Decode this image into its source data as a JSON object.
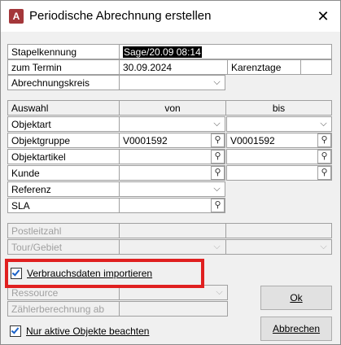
{
  "window": {
    "title": "Periodische Abrechnung erstellen",
    "app_icon_letter": "A",
    "close_glyph": "✕"
  },
  "header_fields": {
    "stapelkennung_label": "Stapelkennung",
    "stapelkennung_value": "Sage/20.09 08:14",
    "termin_label": "zum Termin",
    "termin_value": "30.09.2024",
    "karenztage_label": "Karenztage",
    "karenztage_value": "",
    "abrechnungskreis_label": "Abrechnungskreis",
    "abrechnungskreis_value": ""
  },
  "selection_table": {
    "headers": [
      "Auswahl",
      "von",
      "bis"
    ],
    "rows": [
      {
        "label": "Objektart",
        "von": "",
        "bis": "",
        "control": "dropdown"
      },
      {
        "label": "Objektgruppe",
        "von": "V0001592",
        "bis": "V0001592",
        "control": "lookup"
      },
      {
        "label": "Objektartikel",
        "von": "",
        "bis": "",
        "control": "lookup"
      },
      {
        "label": "Kunde",
        "von": "",
        "bis": "",
        "control": "lookup"
      },
      {
        "label": "Referenz",
        "von": "",
        "control": "dropdown_single"
      },
      {
        "label": "SLA",
        "von": "",
        "control": "lookup_single"
      }
    ]
  },
  "disabled_fields": {
    "postleitzahl_label": "Postleitzahl",
    "tour_label": "Tour/Gebiet",
    "ressource_label": "Ressource",
    "zaehler_label": "Zählerberechnung ab"
  },
  "checkboxes": {
    "verbrauchsdaten_label": "Verbrauchsdaten importieren",
    "verbrauchsdaten_checked": true,
    "nur_aktive_label": "Nur aktive Objekte beachten",
    "nur_aktive_checked": true
  },
  "buttons": {
    "ok_label": "Ok",
    "abbrechen_label": "Abbrechen"
  },
  "icons": {
    "dropdown": "chevron-down-icon",
    "lookup": "magnifier-icon"
  },
  "colors": {
    "highlight_box": "#e02020",
    "checkbox_tick": "#1a62c8",
    "access_icon": "#a4373a"
  }
}
